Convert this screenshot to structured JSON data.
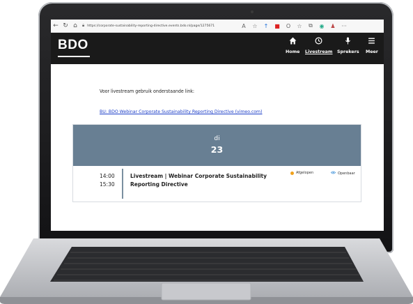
{
  "browser": {
    "url": "https://corporate-sustainability-reporting-directive.events.bdo.nl/page/1275671"
  },
  "site": {
    "logo": "BDO",
    "menu": [
      {
        "label": "Home",
        "icon": "home-icon"
      },
      {
        "label": "Livestream",
        "icon": "clock-icon"
      },
      {
        "label": "Sprekers",
        "icon": "microphone-icon"
      },
      {
        "label": "Meer",
        "icon": "hamburger-icon"
      }
    ]
  },
  "content": {
    "intro": "Voor livestream gebruik onderstaande link:",
    "link": "BU: BDO Webinar Corporate Sustainability Reporting Directive (vimeo.com)"
  },
  "schedule": {
    "day_name": "di",
    "day_number": "23",
    "session": {
      "start": "14:00",
      "end": "15:30",
      "title": "Livestream | Webinar Corporate Sustainability Reporting Directive",
      "status": "Afgelopen",
      "visibility": "Openbaar"
    }
  },
  "colors": {
    "header": "#1a1a1a",
    "card_head": "#687f93",
    "status": "#f0a11c",
    "visibility": "#3a8fd8",
    "link": "#1a3cc7"
  }
}
